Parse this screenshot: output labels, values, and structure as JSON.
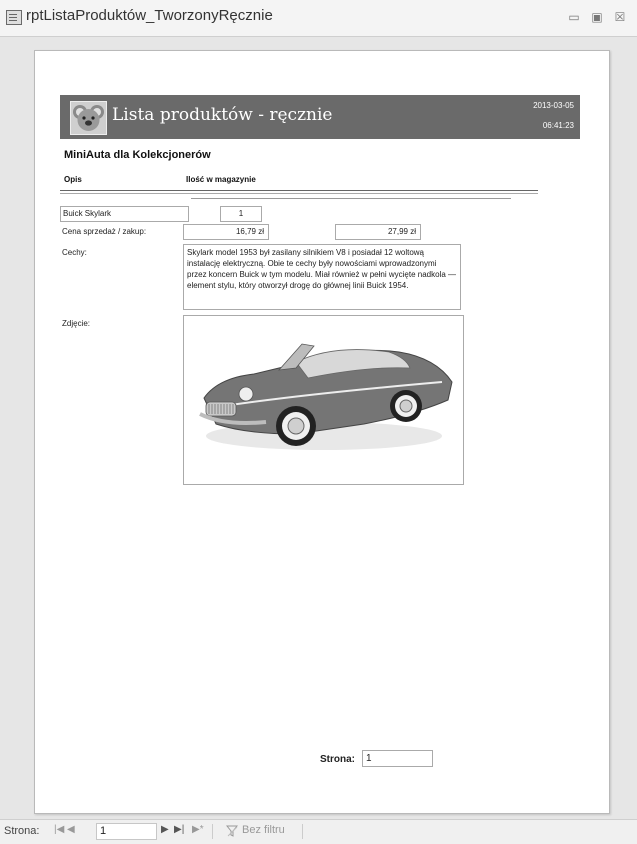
{
  "window": {
    "title": "rptListaProduktów_TworzonyRęcznie",
    "controls": {
      "minimize": "▭",
      "maximize": "▣",
      "close": "☒"
    }
  },
  "report": {
    "title": "Lista produktów - ręcznie",
    "date": "2013-03-05",
    "time": "06:41:23",
    "company": "MiniAuta dla Kolekcjonerów",
    "columns": {
      "opis": "Opis",
      "ilosc": "Ilość w magazynie"
    },
    "product": {
      "name": "Buick Skylark",
      "quantity": "1",
      "price_label": "Cena sprzedaż / zakup:",
      "price_sell": "16,79 zł",
      "price_buy": "27,99 zł",
      "features_label": "Cechy:",
      "features": "Skylark model 1953 był zasilany silnikiem V8 i posiadał 12 woltową instalację elektryczną. Obie te cechy były nowościami wprowadzonymi przez koncern Buick w tym modelu. Miał również w pełni wycięte nadkola — element stylu, który otworzył drogę do głównej linii Buick 1954.",
      "photo_label": "Zdjęcie:"
    },
    "page_label": "Strona:",
    "page_number": "1"
  },
  "navigation": {
    "label": "Strona:",
    "current": "1",
    "filter_label": "Bez filtru"
  },
  "colors": {
    "header_band": "#6a6a6a",
    "page_bg": "#ffffff",
    "window_bg": "#e6e6e6"
  }
}
